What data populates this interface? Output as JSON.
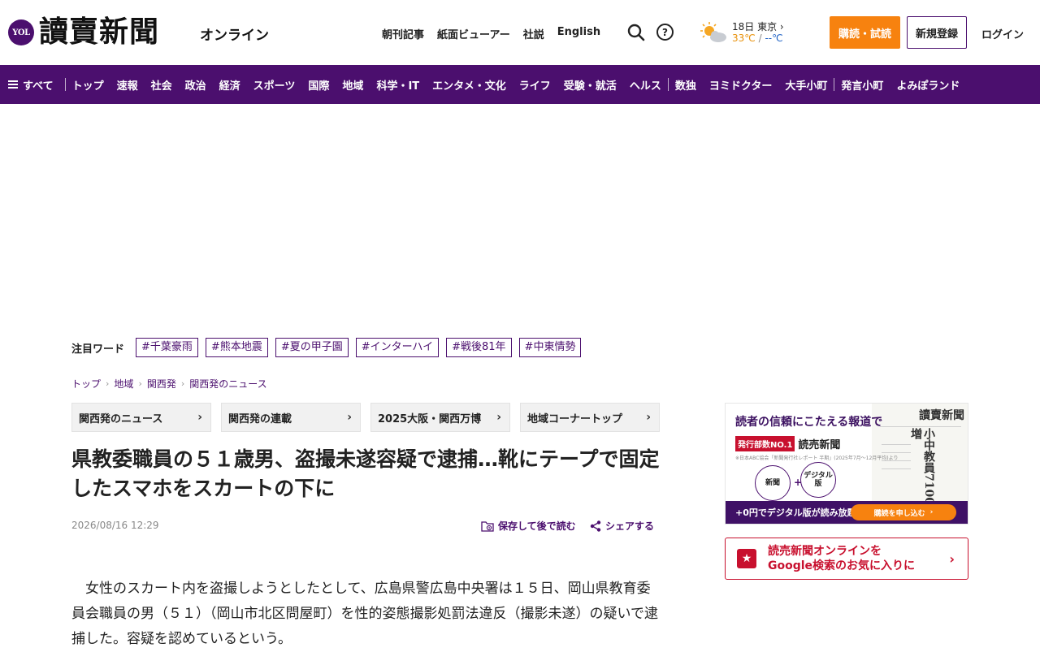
{
  "header": {
    "logo_badge": "YOL",
    "logo_text": "讀賣新聞",
    "logo_suffix": "オンライン",
    "links": [
      "朝刊記事",
      "紙面ビューアー",
      "社説",
      "English"
    ],
    "weather": {
      "date_city": "18日 東京",
      "high": "33℃",
      "sep": "/",
      "low": "--℃"
    },
    "subscribe_label": "購読・試読",
    "register_label": "新規登録",
    "login_label": "ログイン",
    "help_glyph": "?"
  },
  "nav": {
    "all_label": "すべて",
    "groups": [
      [
        "トップ",
        "速報",
        "社会",
        "政治",
        "経済",
        "スポーツ",
        "国際",
        "地域",
        "科学・IT",
        "エンタメ・文化",
        "ライフ",
        "受験・就活",
        "ヘルス"
      ],
      [
        "数独",
        "ヨミドクター",
        "大手小町"
      ],
      [
        "発言小町",
        "よみぽランド"
      ]
    ]
  },
  "hot_words": {
    "label": "注目ワード",
    "tags": [
      "#千葉豪雨",
      "#熊本地震",
      "#夏の甲子園",
      "#インターハイ",
      "#戦後81年",
      "#中東情勢"
    ]
  },
  "breadcrumb": [
    "トップ",
    "地域",
    "関西発",
    "関西発のニュース"
  ],
  "section_tabs": [
    "関西発のニュース",
    "関西発の連載",
    "2025大阪・関西万博",
    "地域コーナートップ"
  ],
  "article": {
    "headline": "県教委職員の５１歳男、盗撮未遂容疑で逮捕…靴にテープで固定したスマホをスカートの下に",
    "date": "2026/08/16 12:29",
    "save_label": "保存して後で読む",
    "share_label": "シェアする",
    "body": "女性のスカート内を盗撮しようとしたとして、広島県警広島中央署は１５日、岡山県教育委員会職員の男（５１）（岡山市北区問屋町）を性的姿態撮影処罰法違反（撮影未遂）の疑いで逮捕した。容疑を認めているという。"
  },
  "promo_subscribe": {
    "headline": "読者の信頼にこたえる報道で",
    "badge": "発行部数NO.1",
    "name": "読売新聞",
    "note": "※日本ABC協会「新聞発行社レポート 半期」(2025年7月～12月平均)より",
    "circle_left": "新聞",
    "circle_right": "デジタル版",
    "plus": "+",
    "bar_text": "+0円でデジタル版が読み放題！",
    "cta": "購読を申し込む",
    "paper_title": "讀賣新聞",
    "paper_headline": "小中教員7100人増"
  },
  "promo_google": {
    "line1": "読売新聞オンラインを",
    "line2": "Google検索のお気に入りに"
  },
  "colors": {
    "brand": "#4b0f6e",
    "accent": "#f7820f",
    "alert": "#c8102e"
  }
}
